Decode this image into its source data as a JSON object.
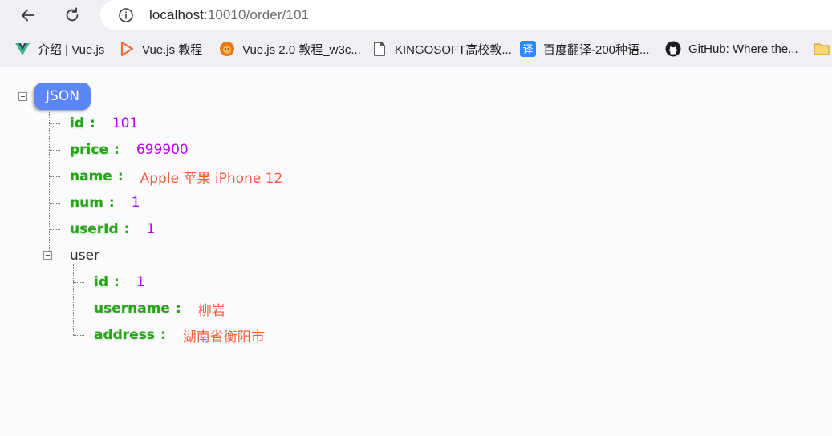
{
  "browser": {
    "url_host": "localhost",
    "url_path": ":10010/order/101"
  },
  "bookmarks": [
    {
      "label": "介绍 | Vue.js",
      "icon": "vue-logo-icon"
    },
    {
      "label": "Vue.js 教程",
      "icon": "runoob-icon"
    },
    {
      "label": "Vue.js 2.0 教程_w3c...",
      "icon": "w3c-lion-icon"
    },
    {
      "label": "KINGOSOFT高校教...",
      "icon": "page-icon"
    },
    {
      "label": "百度翻译-200种语...",
      "icon": "baidu-translate-icon"
    },
    {
      "label": "GitHub: Where the...",
      "icon": "github-icon"
    },
    {
      "label": "",
      "icon": "folder-icon"
    }
  ],
  "json": {
    "root_label": "JSON",
    "fields": [
      {
        "key": "id",
        "sep": ":",
        "value": "101"
      },
      {
        "key": "price",
        "sep": ":",
        "value": "699900"
      },
      {
        "key": "name",
        "sep": ":",
        "value": "Apple 苹果 iPhone 12"
      },
      {
        "key": "num",
        "sep": ":",
        "value": "1"
      },
      {
        "key": "userId",
        "sep": ":",
        "value": "1"
      }
    ],
    "user": {
      "label": "user",
      "fields": [
        {
          "key": "id",
          "sep": ":",
          "value": "1"
        },
        {
          "key": "username",
          "sep": ":",
          "value": "柳岩"
        },
        {
          "key": "address",
          "sep": ":",
          "value": "湖南省衡阳市"
        }
      ]
    }
  },
  "colors": {
    "key": "#2aa21c",
    "number": "#c000ff",
    "string": "#ff5a3c",
    "badge": "#5b86f8"
  }
}
